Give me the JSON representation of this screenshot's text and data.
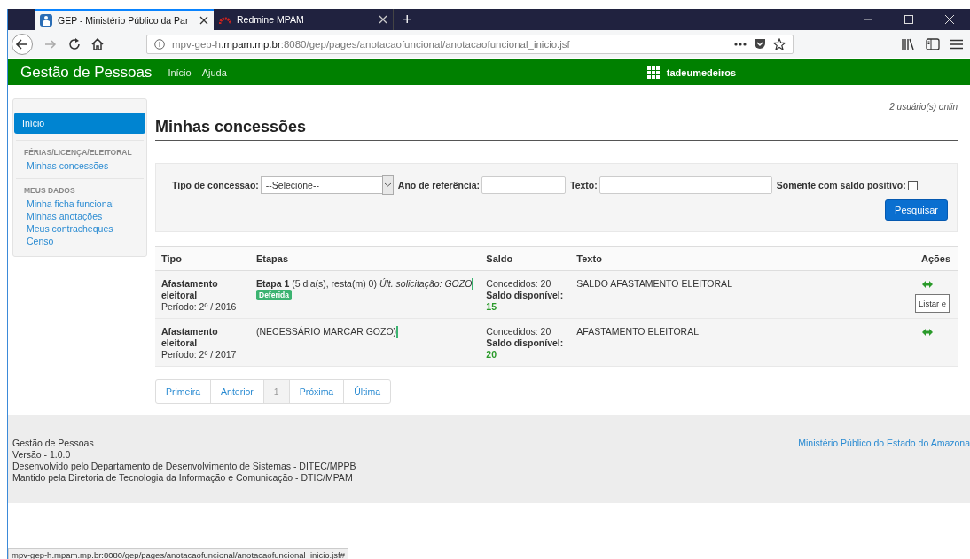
{
  "browser": {
    "tabs": [
      {
        "title": "GEP - Ministério Público da Par",
        "selected": true,
        "kind": "gep"
      },
      {
        "title": "Redmine MPAM",
        "selected": false,
        "kind": "redmine"
      }
    ],
    "new_tab": "+",
    "url": {
      "prefix": "mpv-gep-h.",
      "domain": "mpam.mp.br",
      "path": ":8080/gep/pages/anotacaofuncional/anotacaofuncional_inicio.jsf"
    },
    "status_bar": "mpv-gep-h.mpam.mp.br:8080/gep/pages/anotacaofuncional/anotacaofuncional_inicio.jsf#"
  },
  "navbar": {
    "brand": "Gestão de Pessoas",
    "links": [
      "Início",
      "Ajuda"
    ],
    "user": "tadeumedeiros"
  },
  "sidebar": {
    "items": [
      {
        "kind": "item",
        "label": "Início",
        "selected": true
      },
      {
        "kind": "header",
        "label": "FÉRIAS/LICENÇA/ELEITORAL"
      },
      {
        "kind": "item",
        "label": "Minhas concessões",
        "selected": false
      },
      {
        "kind": "header",
        "label": "MEUS DADOS"
      },
      {
        "kind": "item",
        "label": "Minha ficha funcional",
        "selected": false
      },
      {
        "kind": "item",
        "label": "Minhas anotações",
        "selected": false
      },
      {
        "kind": "item",
        "label": "Meus contracheques",
        "selected": false
      },
      {
        "kind": "item",
        "label": "Censo",
        "selected": false
      }
    ]
  },
  "online": "2 usuário(s) onlin",
  "page_title": "Minhas concessões",
  "filters": {
    "type_label": "Tipo de concessão:",
    "type_value": "--Selecione--",
    "year_label": "Ano de referência:",
    "text_label": "Texto:",
    "positive_label": "Somente com saldo positivo:",
    "positive_checked": false,
    "search_button": "Pesquisar"
  },
  "table": {
    "columns": [
      "Tipo",
      "Etapas",
      "Saldo",
      "Texto",
      "Ações"
    ],
    "rows": [
      {
        "tipo": "Afastamento eleitoral",
        "periodo_label": "Período:",
        "periodo": "2º / 2016",
        "etapas": "**Etapa 1** (5 dia(s), resta(m) 0) *Últ. solicitação: GOZO*",
        "status": "Deferida",
        "concedidos": "Concedidos: 20",
        "saldo_label": "Saldo disponível:",
        "saldo": "15",
        "texto": "SALDO AFASTAMENTO ELEITORAL",
        "tooltip": "Listar e"
      },
      {
        "tipo": "Afastamento eleitoral",
        "periodo_label": "Período:",
        "periodo": "2º / 2017",
        "etapas": "(NECESSÁRIO MARCAR GOZO)",
        "concedidos": "Concedidos: 20",
        "saldo_label": "Saldo disponível:",
        "saldo": "20",
        "texto": "AFASTAMENTO ELEITORAL"
      }
    ]
  },
  "pagination": [
    {
      "label": "Primeira",
      "disabled": false
    },
    {
      "label": "Anterior",
      "disabled": false
    },
    {
      "label": "1",
      "disabled": true
    },
    {
      "label": "Próxima",
      "disabled": false
    },
    {
      "label": "Última",
      "disabled": false
    }
  ],
  "footer": {
    "lines": [
      "Gestão de Pessoas",
      "Versão - 1.0.0",
      "Desenvolvido pelo Departamento de Desenvolvimento de Sistemas - DITEC/MPPB",
      "Mantido pela Diretoria de Tecnologia da Informação e Comunicação - DTIC/MPAM"
    ],
    "link": "Ministério Público do Estado do Amazona"
  }
}
